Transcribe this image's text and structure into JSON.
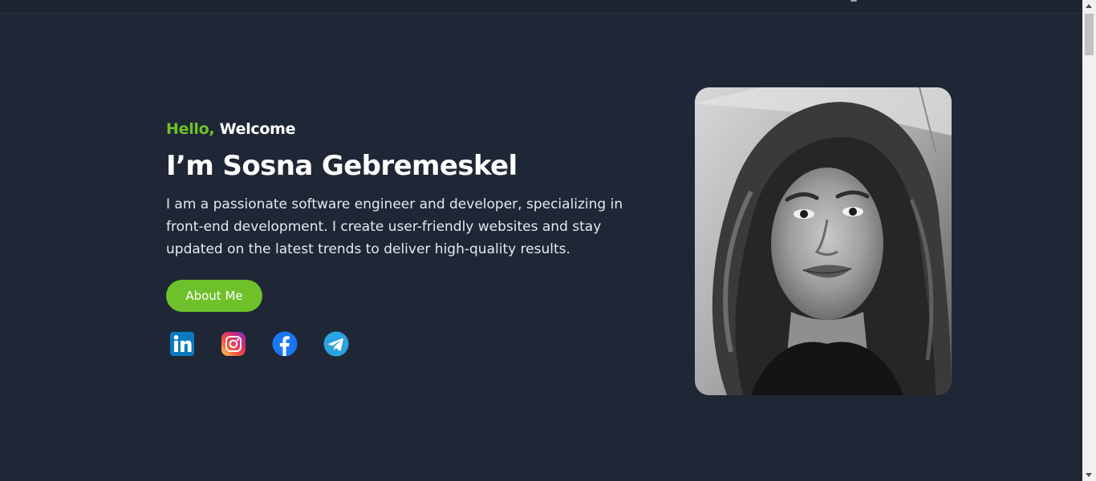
{
  "hero": {
    "greeting_accent": "Hello,",
    "greeting_rest": "Welcome",
    "name": "I’m Sosna Gebremeskel",
    "bio": "I am a passionate software engineer and developer, specializing in front-end development. I create user-friendly websites and stay updated on the latest trends to deliver high-quality results.",
    "about_button": "About Me"
  },
  "socials": [
    {
      "icon": "linkedin-icon"
    },
    {
      "icon": "instagram-icon"
    },
    {
      "icon": "facebook-icon"
    },
    {
      "icon": "telegram-icon"
    }
  ],
  "colors": {
    "background": "#1f2736",
    "accent": "#6ec12b",
    "text": "#ffffff"
  }
}
